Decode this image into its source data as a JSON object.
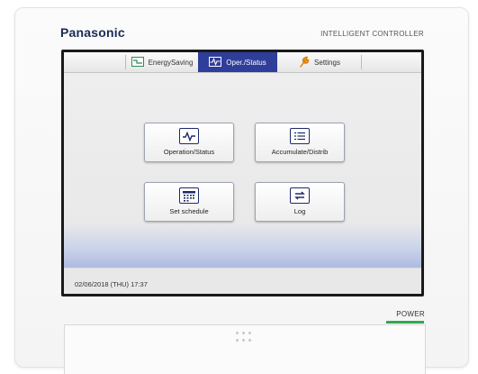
{
  "device": {
    "brand": "Panasonic",
    "model": "INTELLIGENT CONTROLLER",
    "power_label": "POWER",
    "power_led_color": "#2fa84f"
  },
  "tabs": [
    {
      "label": "EnergySaving",
      "icon": "energy-saving-icon",
      "active": false
    },
    {
      "label": "Oper./Status",
      "icon": "waveform-icon",
      "active": true
    },
    {
      "label": "Settings",
      "icon": "wrench-icon",
      "active": false
    }
  ],
  "menu": [
    {
      "label": "Operation/Status",
      "icon": "waveform-icon"
    },
    {
      "label": "Accumulate/Distrib",
      "icon": "list-document-icon"
    },
    {
      "label": "Set schedule",
      "icon": "calendar-icon"
    },
    {
      "label": "Log",
      "icon": "log-icon"
    }
  ],
  "status": {
    "datetime": "02/06/2018 (THU) 17:37"
  },
  "colors": {
    "active_tab": "#2f3e9a",
    "icon_stroke": "#1f2a6a",
    "brand": "#1b2a55"
  }
}
